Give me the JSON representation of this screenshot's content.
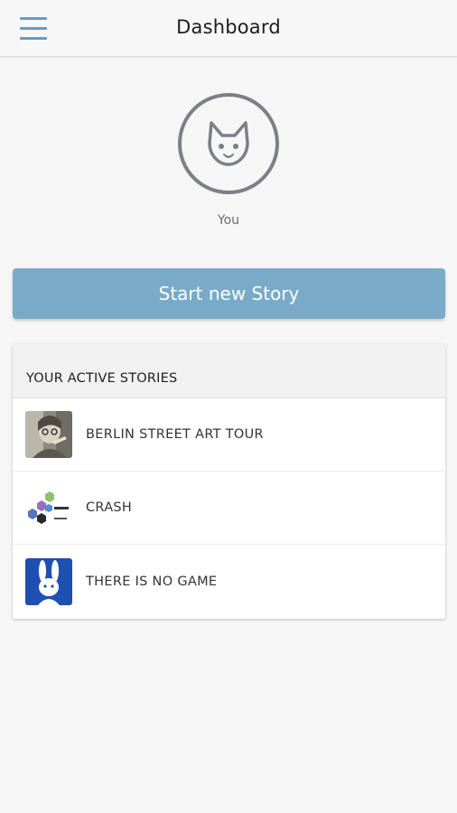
{
  "header": {
    "title": "Dashboard",
    "menu_icon": "hamburger-menu-icon"
  },
  "profile": {
    "avatar_icon": "fox-face-icon",
    "name": "You"
  },
  "actions": {
    "start_label": "Start new Story",
    "button_color": "#79abc9"
  },
  "stories": {
    "header": "YOUR ACTIVE STORIES",
    "items": [
      {
        "title": "BERLIN STREET ART TOUR",
        "thumb": "street-art-photo"
      },
      {
        "title": "CRASH",
        "thumb": "crash-hexagon-logo"
      },
      {
        "title": "THERE IS NO GAME",
        "thumb": "white-rabbit-logo"
      }
    ]
  }
}
